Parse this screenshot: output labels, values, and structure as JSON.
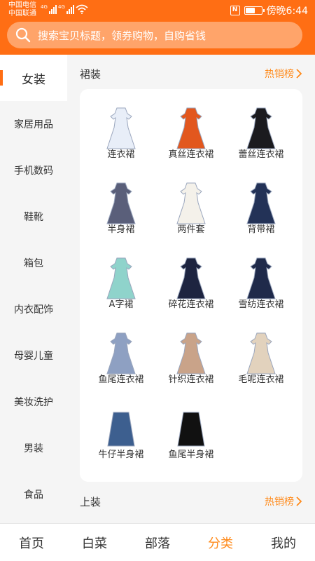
{
  "status_bar": {
    "carrier_1": "中国电信",
    "carrier_2": "中国联通",
    "network_1": "4G",
    "network_2": "4G",
    "time": "傍晚6:44",
    "battery_level": 0.6,
    "icons": [
      "signal-icon",
      "wifi-icon",
      "nfc-icon",
      "battery-icon"
    ]
  },
  "search": {
    "placeholder": "搜索宝贝标题，领券购物，自购省钱",
    "icon": "search-icon"
  },
  "sidebar": {
    "items": [
      {
        "label": "女装",
        "active": true
      },
      {
        "label": "家居用品"
      },
      {
        "label": "手机数码"
      },
      {
        "label": "鞋靴"
      },
      {
        "label": "箱包"
      },
      {
        "label": "内衣配饰"
      },
      {
        "label": "母婴儿童"
      },
      {
        "label": "美妆洗护"
      },
      {
        "label": "男装"
      },
      {
        "label": "食品"
      }
    ]
  },
  "sections": [
    {
      "title": "裙装",
      "link_label": "热销榜",
      "items": [
        {
          "label": "连衣裙",
          "color": "#e8eef8"
        },
        {
          "label": "真丝连衣裙",
          "color": "#e2571e"
        },
        {
          "label": "蕾丝连衣裙",
          "color": "#1b1b1f"
        },
        {
          "label": "半身裙",
          "color": "#5a5f7a"
        },
        {
          "label": "两件套",
          "color": "#f4f1ea"
        },
        {
          "label": "背带裙",
          "color": "#233257"
        },
        {
          "label": "A字裙",
          "color": "#8fd3cb"
        },
        {
          "label": "碎花连衣裙",
          "color": "#1d2440"
        },
        {
          "label": "雪纺连衣裙",
          "color": "#1f2a4a"
        },
        {
          "label": "鱼尾连衣裙",
          "color": "#8ea0c2"
        },
        {
          "label": "针织连衣裙",
          "color": "#c9a389"
        },
        {
          "label": "毛呢连衣裙",
          "color": "#e2d2bd"
        },
        {
          "label": "牛仔半身裙",
          "color": "#3d5f8f"
        },
        {
          "label": "鱼尾半身裙",
          "color": "#111111"
        }
      ]
    },
    {
      "title": "上装",
      "link_label": "热销榜"
    }
  ],
  "bottom_nav": {
    "items": [
      {
        "label": "首页"
      },
      {
        "label": "白菜"
      },
      {
        "label": "部落"
      },
      {
        "label": "分类",
        "active": true
      },
      {
        "label": "我的"
      }
    ]
  },
  "colors": {
    "brand": "#ff6e14",
    "accent": "#ff8a1a",
    "search_bg": "#ffa46a"
  }
}
